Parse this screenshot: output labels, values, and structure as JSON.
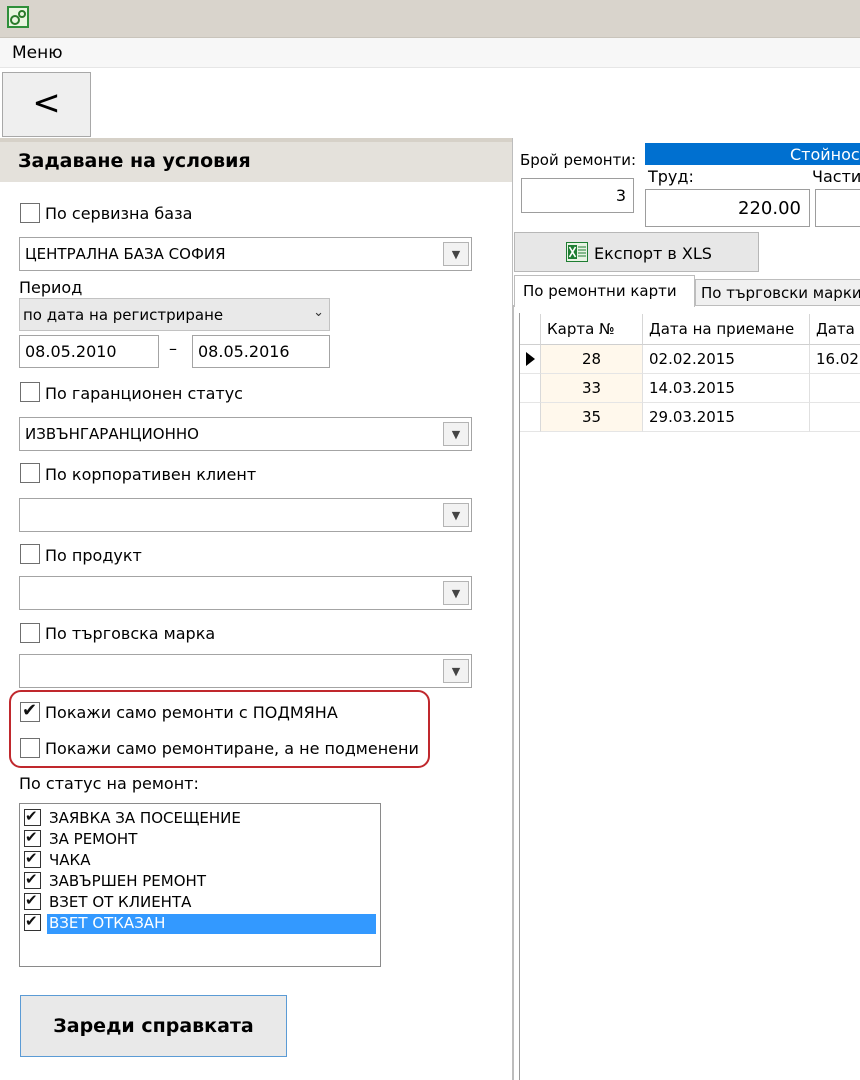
{
  "menu": {
    "label": "Меню"
  },
  "nav": {
    "back_label": "<"
  },
  "conditions": {
    "title": "Задаване на условия",
    "by_service_base": {
      "label": "По сервизна база",
      "checked": false,
      "value": "ЦЕНТРАЛНА БАЗА СОФИЯ"
    },
    "period": {
      "label": "Период",
      "mode": "по дата на регистриране",
      "from": "08.05.2010",
      "separator": "–",
      "to": "08.05.2016"
    },
    "by_warranty_status": {
      "label": "По гаранционен статус",
      "checked": false,
      "value": "ИЗВЪНГАРАНЦИОННО"
    },
    "by_corporate_client": {
      "label": "По корпоративен клиент",
      "checked": false,
      "value": ""
    },
    "by_product": {
      "label": "По продукт",
      "checked": false,
      "value": ""
    },
    "by_trademark": {
      "label": "По търговска марка",
      "checked": false,
      "value": ""
    },
    "show_only_replacement": {
      "label": "Покажи само ремонти с ПОДМЯНА",
      "checked": true
    },
    "show_only_repairs_not_replaced": {
      "label": "Покажи само ремонтиране, а не подменени",
      "checked": false
    },
    "by_repair_status": {
      "label": "По статус на ремонт:",
      "items": [
        {
          "label": "ЗАЯВКА ЗА ПОСЕЩЕНИЕ",
          "checked": true,
          "selected": false
        },
        {
          "label": "ЗА РЕМОНТ",
          "checked": true,
          "selected": false
        },
        {
          "label": "ЧАКА",
          "checked": true,
          "selected": false
        },
        {
          "label": "ЗАВЪРШЕН РЕМОНТ",
          "checked": true,
          "selected": false
        },
        {
          "label": "ВЗЕТ ОТ КЛИЕНТА",
          "checked": true,
          "selected": false
        },
        {
          "label": "ВЗЕТ ОТКАЗАН",
          "checked": true,
          "selected": true
        }
      ]
    },
    "load_button": "Зареди справката"
  },
  "summary": {
    "repairs_count_label": "Брой ремонти:",
    "repairs_count": "3",
    "cost_label": "Стойност",
    "labor_label": "Труд:",
    "labor_value": "220.00",
    "parts_label": "Части",
    "parts_value": ""
  },
  "export": {
    "label": "Експорт в XLS",
    "icon": "excel-icon"
  },
  "tabs": [
    {
      "label": "По ремонтни карти",
      "active": true
    },
    {
      "label": "По търговски марки",
      "active": false
    }
  ],
  "grid": {
    "columns": [
      "Карта №",
      "Дата на приемане",
      "Дата"
    ],
    "rows": [
      [
        "28",
        "02.02.2015",
        "16.02"
      ],
      [
        "33",
        "14.03.2015",
        ""
      ],
      [
        "35",
        "29.03.2015",
        ""
      ]
    ]
  },
  "colors": {
    "accent_blue": "#0070d0",
    "selection_blue": "#3399ff",
    "highlight_red": "#c0282d",
    "first_column_bg": "#fff8ec"
  }
}
